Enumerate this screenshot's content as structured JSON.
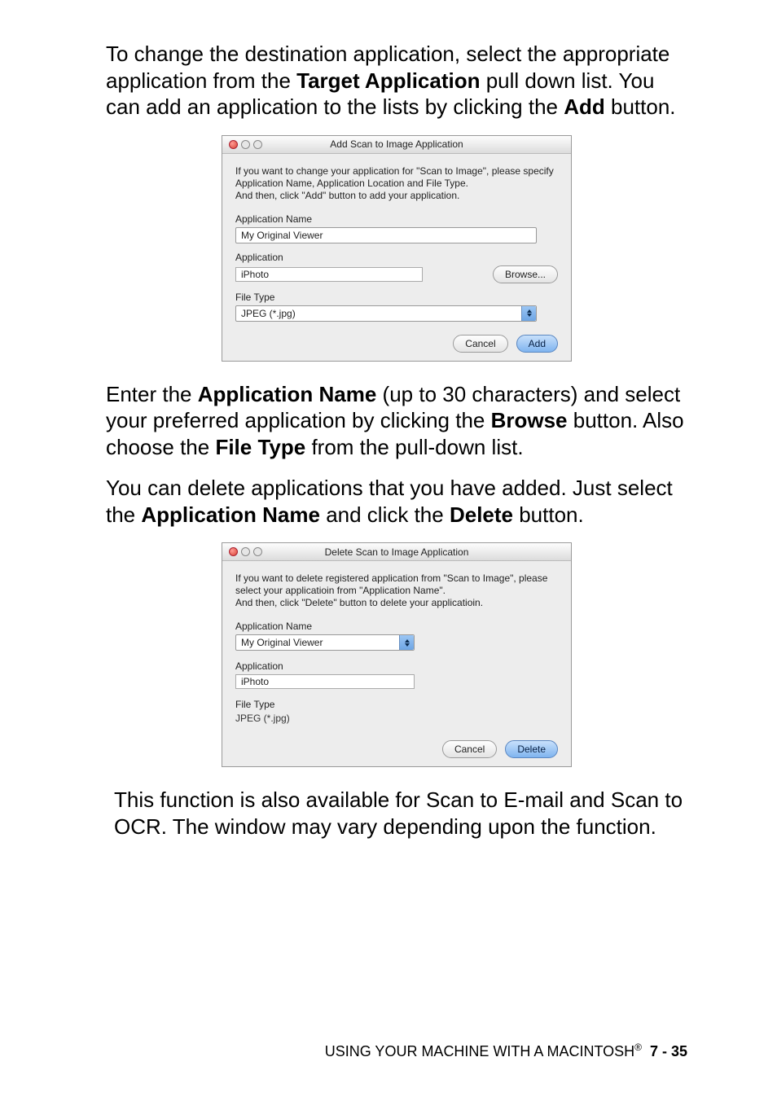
{
  "para1_a": "To change the destination application, select the appropriate application from the ",
  "para1_b": "Target Application",
  "para1_c": " pull down list. You can add an application to the lists by clicking the ",
  "para1_d": "Add",
  "para1_e": " button.",
  "dlg_add": {
    "title": "Add Scan to Image Application",
    "info1": "If you want to change your application for \"Scan to Image\", please specify",
    "info2": "Application Name, Application Location and File Type.",
    "info3": "And then, click \"Add\" button to add your application.",
    "lbl_app_name": "Application Name",
    "val_app_name": "My Original Viewer",
    "lbl_app": "Application",
    "val_app": "iPhoto",
    "browse": "Browse...",
    "lbl_file_type": "File Type",
    "val_file_type": "JPEG (*.jpg)",
    "cancel": "Cancel",
    "add": "Add"
  },
  "para2_a": "Enter the ",
  "para2_b": "Application Name",
  "para2_c": " (up to 30 characters) and select your preferred application by clicking the ",
  "para2_d": "Browse",
  "para2_e": " button. Also choose the ",
  "para2_f": "File Type",
  "para2_g": " from the pull-down list.",
  "para3_a": "You can delete applications that you have added. Just select the ",
  "para3_b": "Application Name",
  "para3_c": " and click the ",
  "para3_d": "Delete",
  "para3_e": " button.",
  "dlg_del": {
    "title": "Delete Scan to Image Application",
    "info1": "If you want to delete registered application from \"Scan to Image\", please",
    "info2": "select your applicatioin from \"Application Name\".",
    "info3": "And then, click \"Delete\" button to delete your applicatioin.",
    "lbl_app_name": "Application Name",
    "val_app_name": "My Original Viewer",
    "lbl_app": "Application",
    "val_app": "iPhoto",
    "lbl_file_type": "File Type",
    "val_file_type": "JPEG (*.jpg)",
    "cancel": "Cancel",
    "delete": "Delete"
  },
  "note": "This function is also available for Scan to E-mail and Scan to OCR. The window may vary depending upon the function.",
  "footer_text": "USING YOUR MACHINE WITH A MACINTOSH",
  "footer_page": "7 - 35"
}
